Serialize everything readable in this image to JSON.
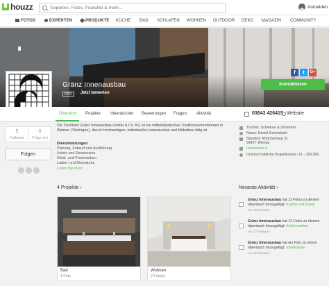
{
  "header": {
    "logo_text": "houzz",
    "search_placeholder": "Experten, Fotos, Produkte & mehr...",
    "login_label": "Anmelden"
  },
  "nav": [
    {
      "label": "Fotos"
    },
    {
      "label": "Experten"
    },
    {
      "label": "Produkte"
    },
    {
      "label": "Küche"
    },
    {
      "label": "Bad"
    },
    {
      "label": "Schlafen"
    },
    {
      "label": "Wohnen"
    },
    {
      "label": "Outdoor"
    },
    {
      "label": "Deko"
    },
    {
      "label": "Magazin"
    },
    {
      "label": "Community"
    }
  ],
  "profile": {
    "name": "Gränz Innenausbau",
    "pro_badge": "PRO",
    "rate_label": "Jetzt bewerten",
    "contact_label": "Kontaktieren",
    "social": [
      "f",
      "t",
      "G+"
    ]
  },
  "tabs": [
    {
      "label": "Übersicht"
    },
    {
      "label": "Projekte"
    },
    {
      "label": "Ideenbücher"
    },
    {
      "label": "Bewertungen"
    },
    {
      "label": "Fragen"
    },
    {
      "label": "Aktivität"
    }
  ],
  "contact_bar": {
    "phone": "03643 426415",
    "website_label": "Website"
  },
  "stats": {
    "followers_count": "5",
    "followers_label": "Follower",
    "following_count": "0",
    "following_label": "Folge ich"
  },
  "follow_label": "Folgen",
  "about": {
    "text": "Die Tischlerei Gränz Innenausbau GmbH & Co. KG ist ein mittelständisches Traditionsunternehmen in Weimar (Thüringen), das im hochwertigen, individuellen Innenausbau und Möbelbau tätig ist.",
    "services_heading": "Dienstleistungen",
    "services": [
      "Planung, Entwurf und Ausführung",
      "Hotels und Restaurants",
      "Klinik- und Praxiseinbau",
      "Laden- und Büroräume"
    ],
    "more_label": "Lesen Sie mehr →"
  },
  "details": [
    {
      "text": "Tischler, Schreiner & Zimmerer"
    },
    {
      "text": "Name: Daniel Kammbach"
    },
    {
      "text": "Standort: Rödchenweg 31"
    },
    {
      "text": "99427 Weimar"
    },
    {
      "text": "Impressum ▾"
    },
    {
      "text": "Durchschnittliche Projektkosten: €1 - 150.000"
    }
  ],
  "projects": {
    "heading": "4 Projekte ›",
    "items": [
      {
        "title": "Bad",
        "count": "1 Foto"
      },
      {
        "title": "Wohnen",
        "count": "2 Foto(s)"
      }
    ]
  },
  "activity": {
    "heading": "Neueste Aktivität ›",
    "items": [
      {
        "who": "Gränz Innenausbau",
        "text": " hat 11 Fotos zu diesem Ideenbuch hinzugefügt: ",
        "target": "Küchen mit Insein",
        "time": "vor 10 Minuten"
      },
      {
        "who": "Gränz Innenausbau",
        "text": " hat 13 Fotos zu diesem Ideenbuch hinzugefügt: ",
        "target": "Küchenzeilen",
        "time": "vor 17 Minuten"
      },
      {
        "who": "Gränz Innenausbau",
        "text": " hat ein Foto zu einem Ideenbuch hinzugefügt: ",
        "target": "Inselküchen",
        "time": "vor 22 Minuten"
      }
    ]
  },
  "colors": {
    "accent": "#4dbd49",
    "facebook": "#3b5998",
    "twitter": "#1da1f2",
    "google": "#dd4b39"
  }
}
